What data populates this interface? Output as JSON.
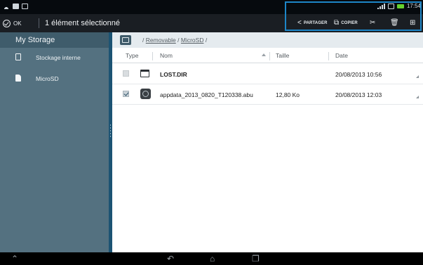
{
  "status_bar": {
    "time": "17:54",
    "left_icons": [
      "wifi-icon",
      "sim-icon",
      "screenshot-icon"
    ],
    "right_icons": [
      "signal-icon",
      "sync-icon",
      "battery-icon"
    ],
    "battery_color": "#66d22f"
  },
  "action_bar": {
    "ok_label": "OK",
    "selection_title": "1 élément sélectionné",
    "actions": [
      {
        "id": "share",
        "label": "PARTAGER",
        "icon": "share-icon"
      },
      {
        "id": "copy",
        "label": "COPIER",
        "icon": "copy-icon"
      },
      {
        "id": "cut",
        "label": "",
        "icon": "scissors-icon"
      },
      {
        "id": "delete",
        "label": "",
        "icon": "trash-icon"
      },
      {
        "id": "more",
        "label": "",
        "icon": "select-all-icon"
      }
    ],
    "highlight_color": "#1d86c8"
  },
  "sidebar": {
    "title": "My Storage",
    "items": [
      {
        "label": "Stockage interne",
        "icon": "phone-storage-icon"
      },
      {
        "label": "MicroSD",
        "icon": "sdcard-icon"
      }
    ]
  },
  "path": {
    "separator": "/",
    "segments": [
      "Removable",
      "MicroSD"
    ]
  },
  "columns": {
    "type": "Type",
    "name": "Nom",
    "size": "Taille",
    "date": "Date"
  },
  "files": [
    {
      "name": "LOST.DIR",
      "size": "",
      "date": "20/08/2013 10:56",
      "kind": "folder",
      "checked": false
    },
    {
      "name": "appdata_2013_0820_T120338.abu",
      "size": "12,80 Ko",
      "date": "20/08/2013 12:03",
      "kind": "backup-file",
      "checked": true
    }
  ],
  "nav_bar": {
    "buttons": [
      "collapse-icon",
      "back-icon",
      "home-icon",
      "recent-apps-icon"
    ]
  }
}
